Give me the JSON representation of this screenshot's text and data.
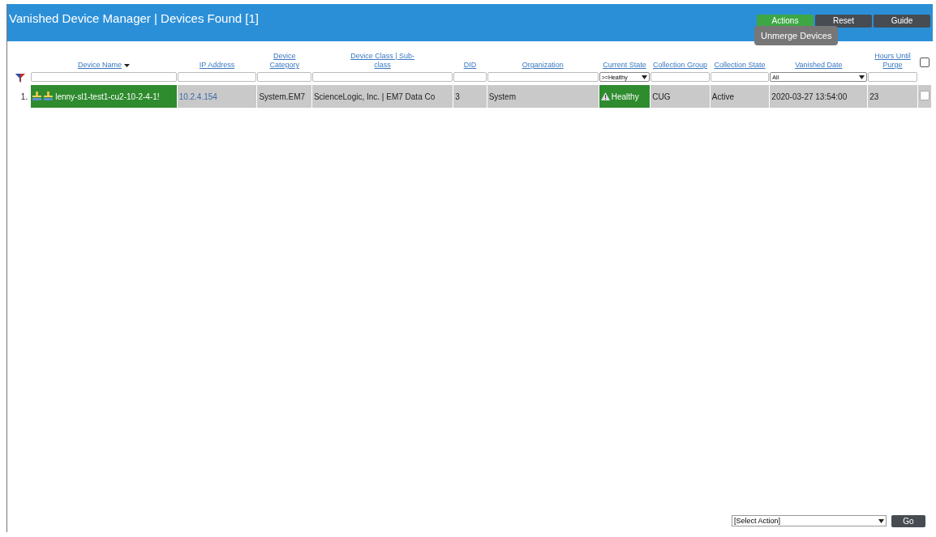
{
  "title": "Vanished Device Manager | Devices Found [1]",
  "header_buttons": [
    {
      "label": "Actions",
      "selected": true
    },
    {
      "label": "Reset",
      "selected": false
    },
    {
      "label": "Guide",
      "selected": false
    }
  ],
  "actions_menu": {
    "expanded": true,
    "items": [
      "Unmerge Devices"
    ]
  },
  "columns": [
    {
      "label": "Device Name",
      "sorted": true,
      "filter": {
        "kind": "text"
      }
    },
    {
      "label": "IP Address",
      "sorted": false,
      "filter": {
        "kind": "text"
      }
    },
    {
      "label": "Device Category",
      "sorted": false,
      "filter": {
        "kind": "text"
      }
    },
    {
      "label": "Device Class | Sub-class",
      "sorted": false,
      "filter": {
        "kind": "text"
      }
    },
    {
      "label": "DID",
      "sorted": false,
      "filter": {
        "kind": "text"
      }
    },
    {
      "label": "Organization",
      "sorted": false,
      "filter": {
        "kind": "text"
      }
    },
    {
      "label": "Current State",
      "sorted": false,
      "filter": {
        "kind": "select",
        "value": ">=Healthy"
      }
    },
    {
      "label": "Collection Group",
      "sorted": false,
      "filter": {
        "kind": "text"
      }
    },
    {
      "label": "Collection State",
      "sorted": false,
      "filter": {
        "kind": "text"
      }
    },
    {
      "label": "Vanished Date",
      "sorted": false,
      "filter": {
        "kind": "select",
        "value": "All"
      }
    },
    {
      "label": "Hours Until Purge",
      "sorted": false,
      "filter": {
        "kind": "text"
      }
    }
  ],
  "select_all": {
    "checked": false
  },
  "rows": [
    {
      "index": "1.",
      "checked": false,
      "cells": [
        {
          "kind": "device",
          "text": "lenny-sl1-test1-cu2-10-2-4-1!"
        },
        {
          "kind": "link",
          "text": "10.2.4.154"
        },
        {
          "kind": "plain",
          "text": "System.EM7"
        },
        {
          "kind": "plain",
          "text": "ScienceLogic, Inc. | EM7 Data Co"
        },
        {
          "kind": "plain",
          "text": "3"
        },
        {
          "kind": "plain",
          "text": "System"
        },
        {
          "kind": "state",
          "text": "Healthy"
        },
        {
          "kind": "plain",
          "text": "CUG"
        },
        {
          "kind": "plain",
          "text": "Active"
        },
        {
          "kind": "plain",
          "text": "2020-03-27 13:54:00"
        },
        {
          "kind": "plain",
          "text": "23"
        }
      ]
    }
  ],
  "footer": {
    "action_select": "[Select Action]",
    "go_button": "Go"
  }
}
